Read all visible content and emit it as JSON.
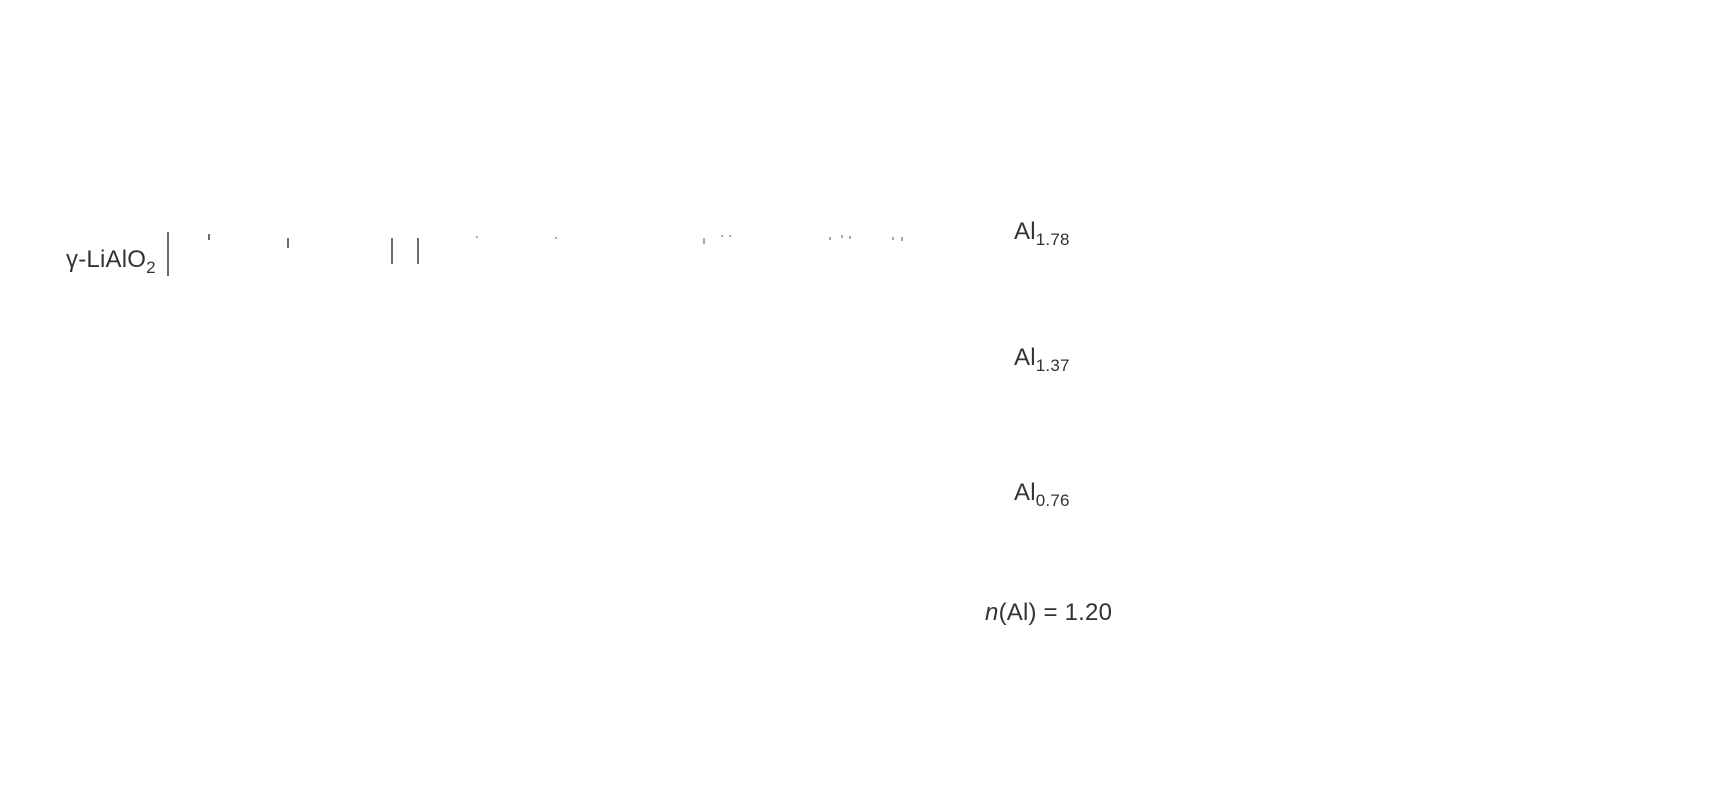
{
  "compound": {
    "prefix": "γ-",
    "li": "Li",
    "al": "AlO",
    "sub": "2"
  },
  "labels": [
    {
      "element": "Al",
      "sub": "1.78"
    },
    {
      "element": "Al",
      "sub": "1.37"
    },
    {
      "element": "Al",
      "sub": "0.76"
    }
  ],
  "nal": {
    "var": "n",
    "rest": "(Al) = 1.20"
  }
}
